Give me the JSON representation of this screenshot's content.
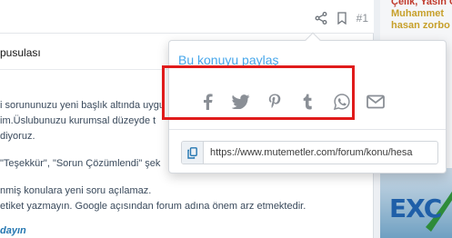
{
  "post": {
    "post_number": "#1",
    "title": "pusulası",
    "body_lines": [
      "i sorununuzu yeni başlık altında uygu",
      "im.Üslubunuzu kurumsal düzeyde t",
      "diyoruz.",
      "\"Teşekkür\", \"Sorun Çözümlendi\" şek",
      "nmiş konulara yeni soru açılamaz.",
      "etiket yazmayın. Google açısından forum adına önem arz etmektedir."
    ],
    "footer_link": "dayın"
  },
  "sidebar": {
    "names": [
      "Çelik, Yasin Ö",
      "Muhammet",
      "hasan zorbo"
    ],
    "banner_text": "EXC"
  },
  "share_popup": {
    "title": "Bu konuyu paylaş",
    "buttons": [
      {
        "name": "facebook",
        "label": "Facebook"
      },
      {
        "name": "twitter",
        "label": "Twitter"
      },
      {
        "name": "pinterest",
        "label": "Pinterest"
      },
      {
        "name": "tumblr",
        "label": "Tumblr"
      },
      {
        "name": "whatsapp",
        "label": "WhatsApp"
      },
      {
        "name": "email",
        "label": "E-posta"
      }
    ],
    "url": "https://www.mutemetler.com/forum/konu/hesa"
  },
  "colors": {
    "accent": "#47a7eb",
    "highlight": "#e01b1b",
    "icon": "#8a8f96"
  }
}
